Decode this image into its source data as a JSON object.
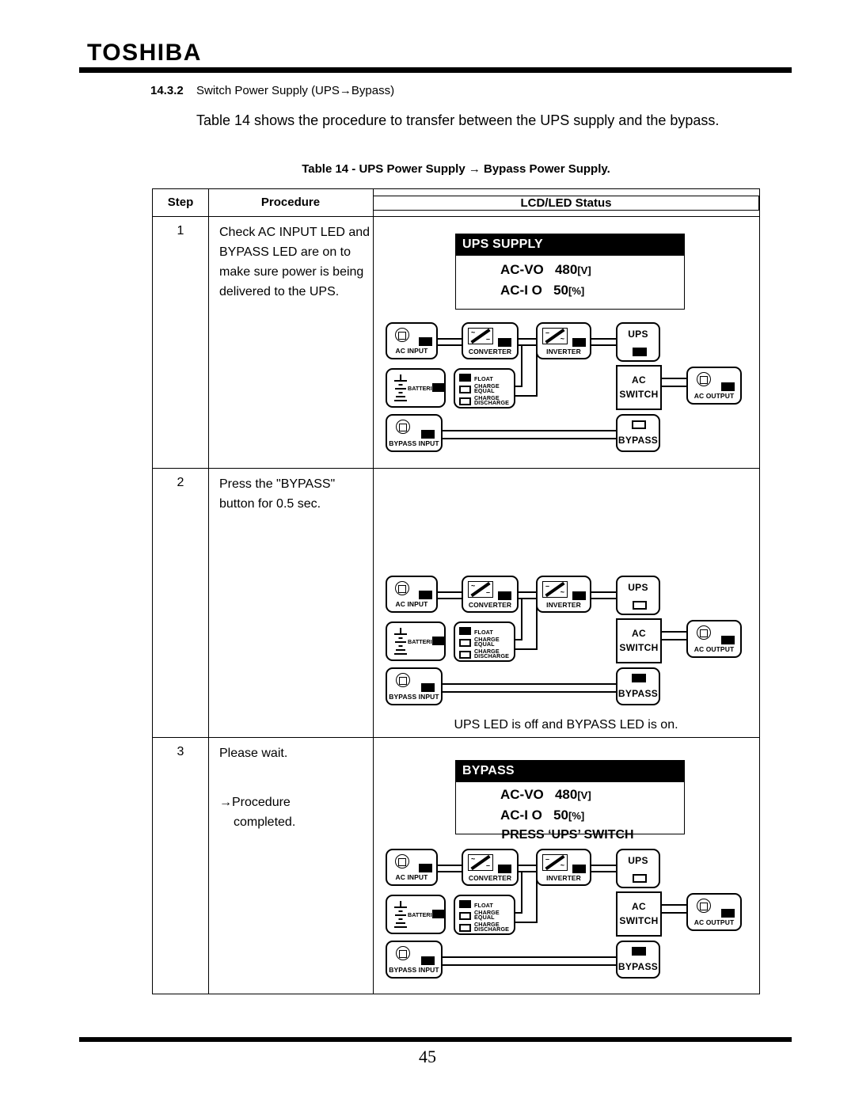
{
  "header": {
    "brand": "TOSHIBA"
  },
  "footer": {
    "page_number": "45"
  },
  "section": {
    "number": "14.3.2",
    "title": "Switch Power Supply (UPS→Bypass)",
    "paragraph": "Table 14 shows the procedure to transfer between the UPS supply and the bypass."
  },
  "table": {
    "caption": "Table 14 - UPS Power Supply → Bypass Power Supply.",
    "columns": [
      "Step",
      "Procedure",
      "LCD/LED Status"
    ],
    "rows": [
      {
        "step": "1",
        "procedure": "Check AC INPUT LED and BYPASS LED are on to make sure power is being delivered to the UPS.",
        "lcd": {
          "title": "UPS SUPPLY",
          "line1_label": "AC-VO",
          "line1_value": "480",
          "line1_unit": "[V]",
          "line2_label": "AC-I O",
          "line2_value": "50",
          "line2_unit": "[%]",
          "line3": ""
        },
        "note": ""
      },
      {
        "step": "2",
        "procedure": "Press the \"BYPASS\" button for 0.5 sec.",
        "lcd": null,
        "note": "UPS LED is off and BYPASS LED is on."
      },
      {
        "step": "3",
        "procedure_line1": "Please wait.",
        "procedure_line2": "→Procedure",
        "procedure_line3": "completed.",
        "lcd": {
          "title": "BYPASS",
          "line1_label": "AC-VO",
          "line1_value": "480",
          "line1_unit": "[V]",
          "line2_label": "AC-I O",
          "line2_value": "50",
          "line2_unit": "[%]",
          "line3": "PRESS ‘UPS’ SWITCH"
        },
        "note": ""
      }
    ]
  },
  "diagram_labels": {
    "ac_input": "AC INPUT",
    "converter": "CONVERTER",
    "inverter": "INVERTER",
    "ups": "UPS",
    "ac_switch_l1": "AC",
    "ac_switch_l2": "SWITCH",
    "ac_output": "AC OUTPUT",
    "batteries": "BATTERIES",
    "float_charge": "FLOAT CHARGE",
    "equal_charge": "EQUAL CHARGE",
    "discharge": "DISCHARGE",
    "bypass_input": "BYPASS INPUT",
    "bypass": "BYPASS"
  },
  "diagram_states": [
    {
      "name": "step1-diagram",
      "ac_input_led": "on",
      "converter_led": "on",
      "inverter_led": "on",
      "ups_led": "on",
      "ac_output_led": "on",
      "batteries_led": "on",
      "float_charge_led": "on",
      "equal_charge_led": "off",
      "discharge_led": "off",
      "bypass_input_led": "on",
      "bypass_led": "off"
    },
    {
      "name": "step2-diagram",
      "ac_input_led": "on",
      "converter_led": "on",
      "inverter_led": "on",
      "ups_led": "off",
      "ac_output_led": "on",
      "batteries_led": "on",
      "float_charge_led": "on",
      "equal_charge_led": "off",
      "discharge_led": "off",
      "bypass_input_led": "on",
      "bypass_led": "on"
    },
    {
      "name": "step3-diagram",
      "ac_input_led": "on",
      "converter_led": "on",
      "inverter_led": "on",
      "ups_led": "off",
      "ac_output_led": "on",
      "batteries_led": "on",
      "float_charge_led": "on",
      "equal_charge_led": "off",
      "discharge_led": "off",
      "bypass_input_led": "on",
      "bypass_led": "on"
    }
  ],
  "colors": {
    "ink": "#000000",
    "paper": "#ffffff",
    "led_on": "#000000",
    "led_off": "#ffffff"
  }
}
